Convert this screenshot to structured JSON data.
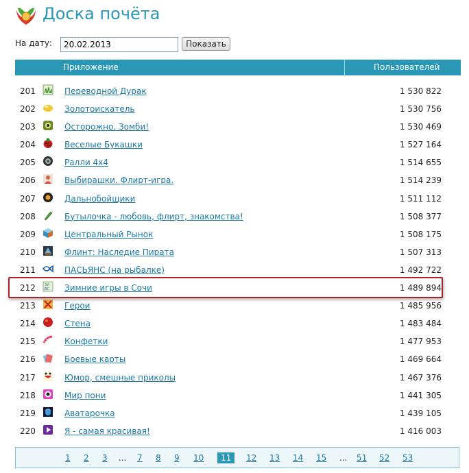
{
  "header": {
    "title": "Доска почёта"
  },
  "date_form": {
    "label": "На дату:",
    "date_value": "20.02.2013",
    "show_label": "Показать"
  },
  "table": {
    "col_app": "Приложение",
    "col_users": "Пользователей",
    "rows": [
      {
        "rank": "201",
        "icon": "grass-icon",
        "name": "Переводной Дурак",
        "users": "1 530 822"
      },
      {
        "rank": "202",
        "icon": "gold-nugget-icon",
        "name": "Золотоискатель",
        "users": "1 530 756"
      },
      {
        "rank": "203",
        "icon": "zombie-icon",
        "name": "Осторожно, Зомби!",
        "users": "1 530 469"
      },
      {
        "rank": "204",
        "icon": "ladybug-icon",
        "name": "Веселые Букашки",
        "users": "1 527 164"
      },
      {
        "rank": "205",
        "icon": "wheel-icon",
        "name": "Ралли 4х4",
        "users": "1 514 655"
      },
      {
        "rank": "206",
        "icon": "person-icon",
        "name": "Выбирашки. Флирт-игра.",
        "users": "1 514 239"
      },
      {
        "rank": "207",
        "icon": "truck-wheel-icon",
        "name": "Дальнобойщики",
        "users": "1 511 112"
      },
      {
        "rank": "208",
        "icon": "bottle-icon",
        "name": "Бутылочка - любовь, флирт, знакомства!",
        "users": "1 508 377"
      },
      {
        "rank": "209",
        "icon": "market-cube-icon",
        "name": "Центральный Рынок",
        "users": "1 508 175"
      },
      {
        "rank": "210",
        "icon": "pirate-icon",
        "name": "Флинт: Наследие Пирата",
        "users": "1 507 313"
      },
      {
        "rank": "211",
        "icon": "fish-icon",
        "name": "ПАСЬЯНС (на рыбалке)",
        "users": "1 492 722"
      },
      {
        "rank": "212",
        "icon": "winter-games-icon",
        "name": "Зимние игры в Сочи",
        "users": "1 489 894"
      },
      {
        "rank": "213",
        "icon": "crossed-swords-icon",
        "name": "Герои",
        "users": "1 485 956"
      },
      {
        "rank": "214",
        "icon": "red-circle-icon",
        "name": "Стена",
        "users": "1 483 484"
      },
      {
        "rank": "215",
        "icon": "candy-icon",
        "name": "Конфетки",
        "users": "1 477 953"
      },
      {
        "rank": "216",
        "icon": "cards-icon",
        "name": "Боевые карты",
        "users": "1 469 664"
      },
      {
        "rank": "217",
        "icon": "smile-icon",
        "name": "Юмор, смешные приколы",
        "users": "1 467 376"
      },
      {
        "rank": "218",
        "icon": "pony-eye-icon",
        "name": "Мир пони",
        "users": "1 441 305"
      },
      {
        "rank": "219",
        "icon": "avatar-icon",
        "name": "Аватарочка",
        "users": "1 439 105"
      },
      {
        "rank": "220",
        "icon": "play-icon",
        "name": "Я - самая красивая!",
        "users": "1 416 003"
      }
    ]
  },
  "pagination": {
    "items": [
      "1",
      "2",
      "3",
      "...",
      "7",
      "8",
      "9",
      "10",
      "11",
      "12",
      "13",
      "14",
      "15",
      "...",
      "51",
      "52",
      "53"
    ],
    "current": "11"
  },
  "colors": {
    "accent": "#2a97b5",
    "link": "#1a78a6",
    "highlight_border": "#a8262a"
  }
}
